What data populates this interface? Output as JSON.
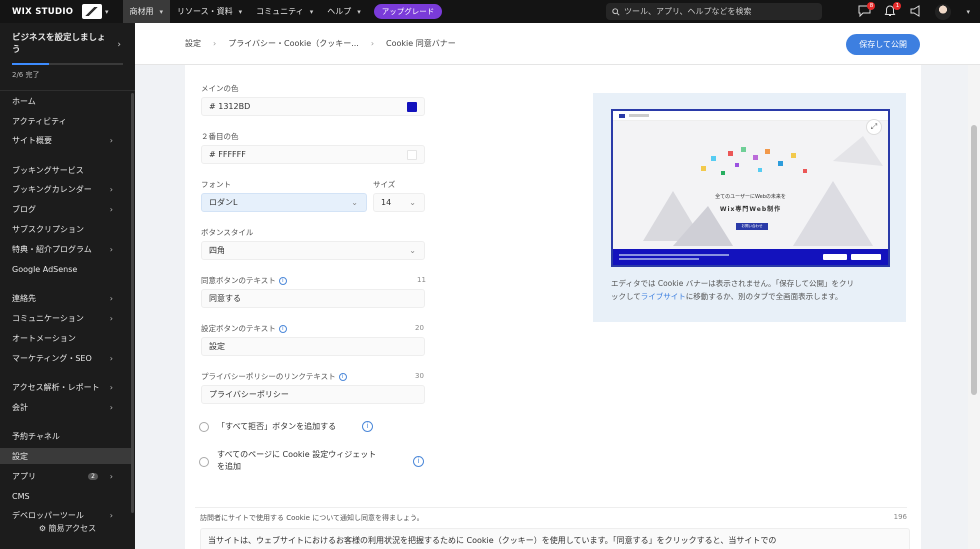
{
  "topbar": {
    "brand": "WIX STUDIO",
    "menu": [
      {
        "label": "商材用",
        "active": true
      },
      {
        "label": "リソース・資料",
        "active": false
      },
      {
        "label": "コミュニティ",
        "active": false
      },
      {
        "label": "ヘルプ",
        "active": false
      }
    ],
    "upgrade": "アップグレード",
    "search_placeholder": "ツール、アプリ、ヘルプなどを検索",
    "chat_badge": "8",
    "notif_badge": "1"
  },
  "sidebar": {
    "setup_title": "ビジネスを設定しましょう",
    "setup_progress": "2/6 完了",
    "setup_progress_fraction": 0.33,
    "items": [
      {
        "label": "ホーム",
        "chevron": false
      },
      {
        "label": "アクティビティ",
        "chevron": false
      },
      {
        "label": "サイト概要",
        "chevron": true
      },
      {
        "label": "ブッキングサービス",
        "chevron": false
      },
      {
        "label": "ブッキングカレンダー",
        "chevron": true
      },
      {
        "label": "ブログ",
        "chevron": true
      },
      {
        "label": "サブスクリプション",
        "chevron": false
      },
      {
        "label": "特典・紹介プログラム",
        "chevron": true
      },
      {
        "label": "Google AdSense",
        "chevron": false
      },
      {
        "label": "連絡先",
        "chevron": true
      },
      {
        "label": "コミュニケーション",
        "chevron": true
      },
      {
        "label": "オートメーション",
        "chevron": false
      },
      {
        "label": "マーケティング・SEO",
        "chevron": true
      },
      {
        "label": "アクセス解析・レポート",
        "chevron": true
      },
      {
        "label": "会計",
        "chevron": true
      },
      {
        "label": "予約チャネル",
        "chevron": false
      },
      {
        "label": "設定",
        "chevron": false
      },
      {
        "label": "アプリ",
        "chevron": true,
        "pill": "2"
      },
      {
        "label": "CMS",
        "chevron": false
      },
      {
        "label": "デベロッパーツール",
        "chevron": true
      }
    ],
    "footer": "簡易アクセス"
  },
  "breadcrumb": {
    "items": [
      "設定",
      "プライバシー・Cookie（クッキー...",
      "Cookie 同意バナー"
    ],
    "publish": "保存して公開"
  },
  "form": {
    "main_color_label": "メインの色",
    "main_color_value": "# 1312BD",
    "main_color_hex": "#1312BD",
    "second_color_label": "２番目の色",
    "second_color_value": "# FFFFFF",
    "second_color_hex": "#FFFFFF",
    "font_label": "フォント",
    "font_value": "ロダンL",
    "size_label": "サイズ",
    "size_value": "14",
    "button_style_label": "ボタンスタイル",
    "button_style_value": "四角",
    "accept_label": "同意ボタンのテキスト",
    "accept_count": "11",
    "accept_value": "同意する",
    "settings_label": "設定ボタンのテキスト",
    "settings_count": "20",
    "settings_value": "設定",
    "privacy_label": "プライバシーポリシーのリンクテキスト",
    "privacy_count": "30",
    "privacy_value": "プライバシーポリシー",
    "reject_all_label": "「すべて拒否」ボタンを追加する",
    "widget_label_1": "すべてのページに Cookie 設定ウィジェット",
    "widget_label_2": "を追加"
  },
  "preview": {
    "site_title": "全てのユーザーにWebの未来を",
    "site_subtitle": "Wix専門Web制作",
    "site_button": "お問い合わせ",
    "note_1": "エディタでは Cookie バナーは表示されません。「保存して公開」をクリ",
    "note_2a": "ックして",
    "note_link": "ライブサイト",
    "note_2b": "に移動するか、別のタブで全画面表示します。"
  },
  "notice": {
    "label": "訪問者にサイトで使用する Cookie について通知し同意を得ましょう。",
    "count": "196",
    "text": "当サイトは、ウェブサイトにおけるお客様の利用状況を把握するために Cookie（クッキー）を使用しています。「同意する」をクリックすると、当サイトでの"
  }
}
